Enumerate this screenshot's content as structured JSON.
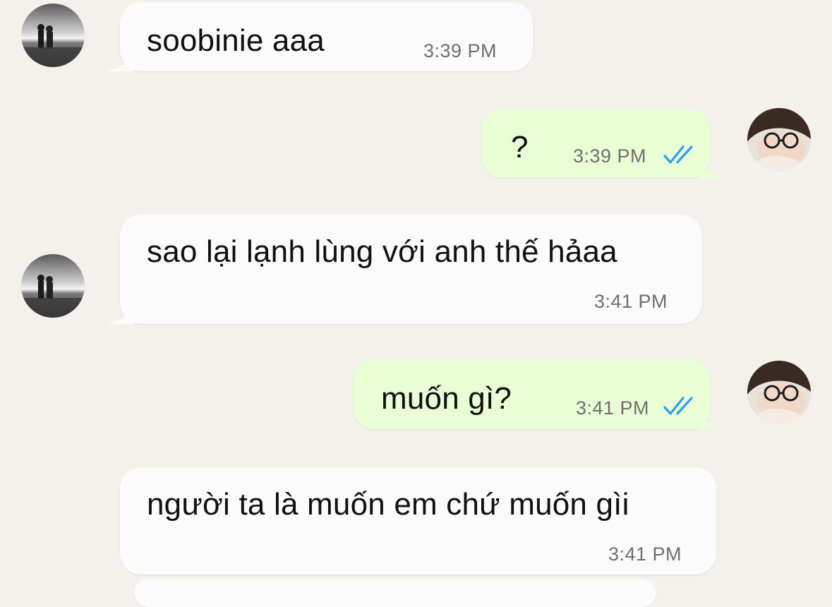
{
  "chat": {
    "messages": [
      {
        "direction": "incoming",
        "text": "soobinie aaa",
        "time": "3:39 PM",
        "avatar": "sunset-couple-avatar"
      },
      {
        "direction": "outgoing",
        "text": "?",
        "time": "3:39 PM",
        "status": "read",
        "avatar": "user-glasses-avatar"
      },
      {
        "direction": "incoming",
        "text": "sao lại lạnh lùng với anh thế hảaa",
        "time": "3:41 PM",
        "avatar": "sunset-couple-avatar"
      },
      {
        "direction": "outgoing",
        "text": "muốn gì?",
        "time": "3:41 PM",
        "status": "read",
        "avatar": "user-glasses-avatar"
      },
      {
        "direction": "incoming",
        "text": "người ta là muốn em chứ muốn gìi",
        "time": "3:41 PM",
        "avatar": "none"
      }
    ]
  },
  "colors": {
    "background": "#f4f0eb",
    "incoming_bubble": "#fbfbfb",
    "outgoing_bubble": "#eafed6",
    "read_ticks": "#2c9cf2",
    "timestamp": "#6f6f6f"
  },
  "icons": {
    "read_receipt": "double-check-icon"
  }
}
